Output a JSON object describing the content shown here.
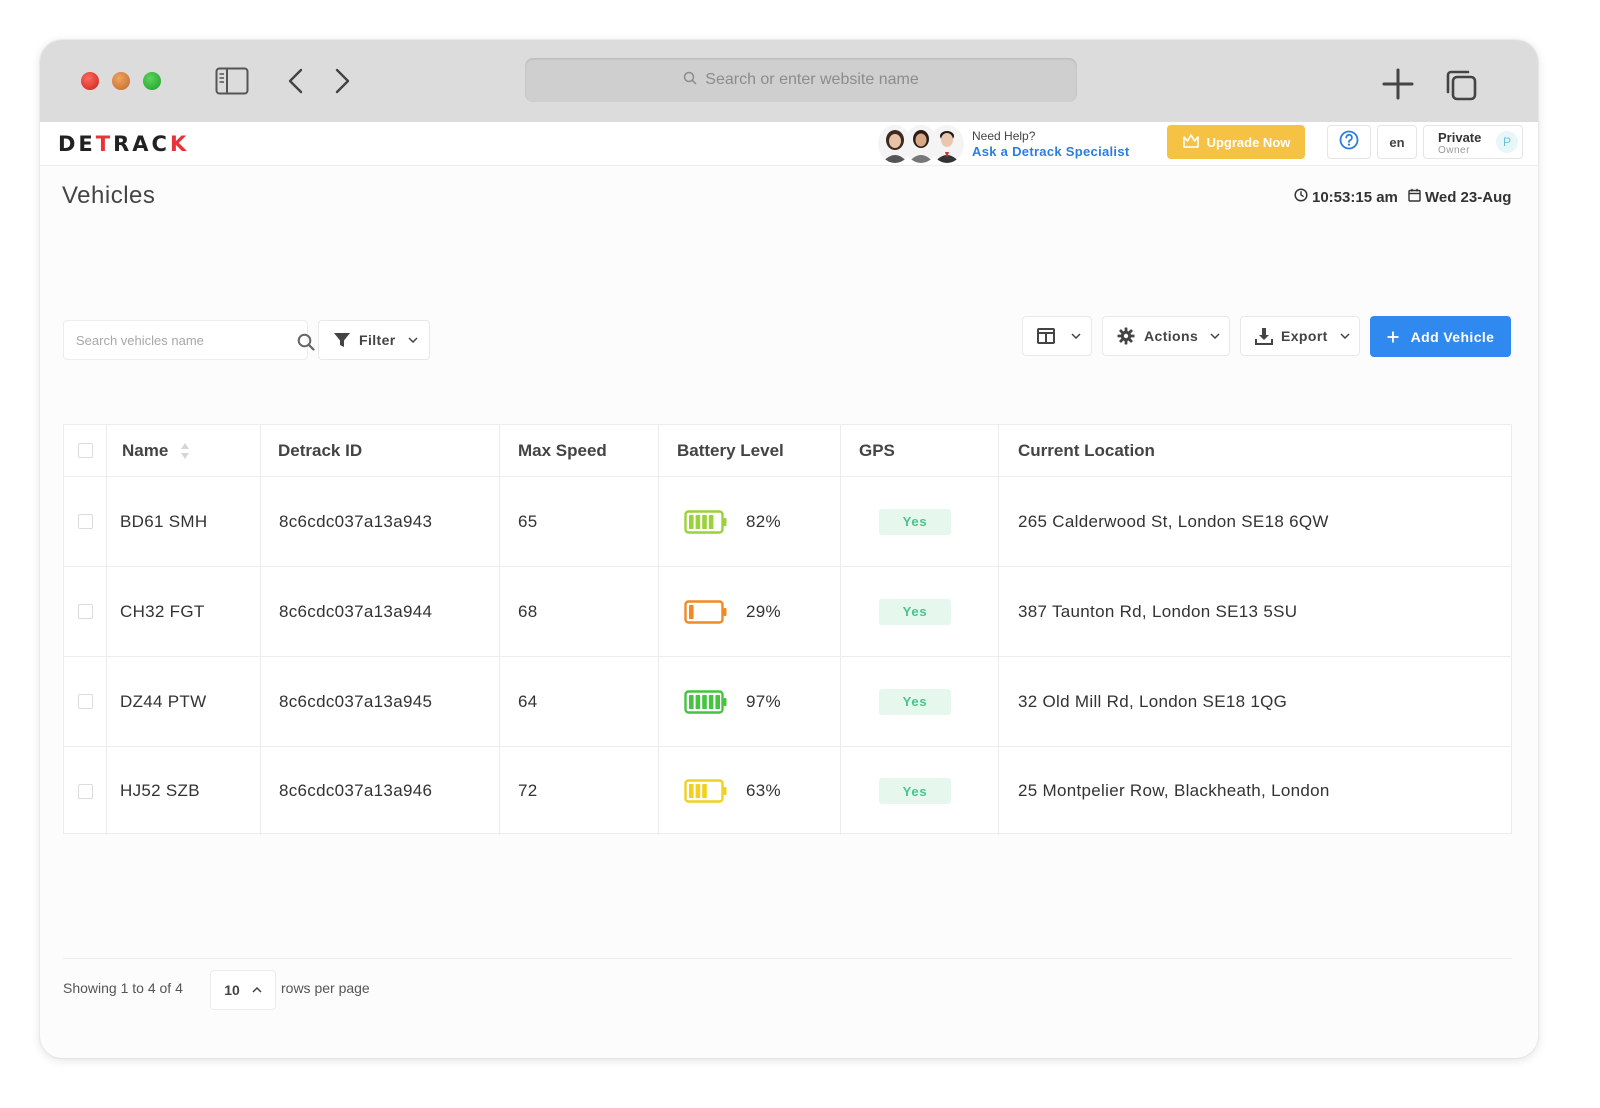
{
  "browser": {
    "address_placeholder": "Search or enter website name"
  },
  "header": {
    "logo": "DETRACK",
    "help": {
      "line1": "Need Help?",
      "line2": "Ask a Detrack Specialist"
    },
    "upgrade_label": "Upgrade Now",
    "language": "en",
    "profile": {
      "name": "Private",
      "role": "Owner",
      "avatar_initial": "P"
    }
  },
  "page": {
    "title": "Vehicles",
    "time": "10:53:15 am",
    "date": "Wed 23-Aug"
  },
  "toolbar": {
    "search_placeholder": "Search vehicles name",
    "filter_label": "Filter",
    "actions_label": "Actions",
    "export_label": "Export",
    "add_label": "Add Vehicle"
  },
  "table": {
    "columns": [
      "Name",
      "Detrack ID",
      "Max Speed",
      "Battery Level",
      "GPS",
      "Current Location"
    ],
    "rows": [
      {
        "name": "BD61 SMH",
        "id": "8c6cdc037a13a943",
        "max_speed": "65",
        "battery": "82%",
        "battery_level": 0.82,
        "battery_color": "#9bd13a",
        "gps": "Yes",
        "location": "265 Calderwood St, London SE18 6QW"
      },
      {
        "name": "CH32 FGT",
        "id": "8c6cdc037a13a944",
        "max_speed": "68",
        "battery": "29%",
        "battery_level": 0.29,
        "battery_color": "#f08a24",
        "gps": "Yes",
        "location": "387 Taunton Rd, London SE13 5SU"
      },
      {
        "name": "DZ44 PTW",
        "id": "8c6cdc037a13a945",
        "max_speed": "64",
        "battery": "97%",
        "battery_level": 0.97,
        "battery_color": "#46c341",
        "gps": "Yes",
        "location": "32 Old Mill Rd, London SE18 1QG"
      },
      {
        "name": "HJ52 SZB",
        "id": "8c6cdc037a13a946",
        "max_speed": "72",
        "battery": "63%",
        "battery_level": 0.63,
        "battery_color": "#f2d01e",
        "gps": "Yes",
        "location": "25 Montpelier Row, Blackheath, London"
      }
    ]
  },
  "pagination": {
    "showing": "Showing 1 to 4 of 4",
    "per_page": "10",
    "rows_per_page_label": "rows per page"
  },
  "colors": {
    "accent": "#2f89ee",
    "upgrade": "#f5c243",
    "brand_red": "#e8333a",
    "gps_bg": "#e6f7ee",
    "gps_text": "#4cc38a"
  }
}
